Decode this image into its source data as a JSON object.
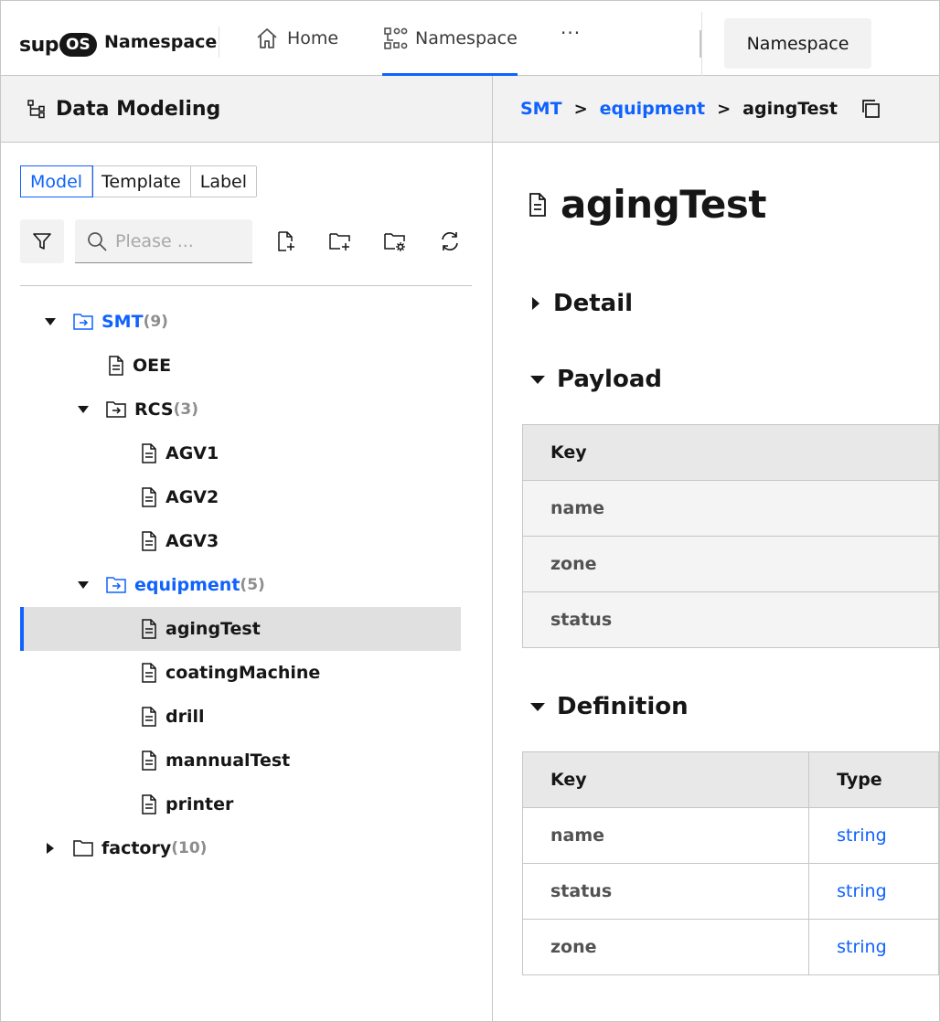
{
  "topnav": {
    "logo_sup": "sup",
    "logo_os": "OS",
    "app_name": "Namespace",
    "home_label": "Home",
    "namespace_label": "Namespace",
    "more_label": "···",
    "namespace_button": "Namespace"
  },
  "left": {
    "title": "Data Modeling",
    "tabs": [
      "Model",
      "Template",
      "Label"
    ],
    "active_tab": "Model",
    "search_placeholder": "Please ...",
    "tree": [
      {
        "label": "SMT",
        "count": "(9)"
      },
      {
        "label": "OEE"
      },
      {
        "label": "RCS",
        "count": "(3)"
      },
      {
        "label": "AGV1"
      },
      {
        "label": "AGV2"
      },
      {
        "label": "AGV3"
      },
      {
        "label": "equipment",
        "count": "(5)"
      },
      {
        "label": "agingTest"
      },
      {
        "label": "coatingMachine"
      },
      {
        "label": "drill"
      },
      {
        "label": "mannualTest"
      },
      {
        "label": "printer"
      },
      {
        "label": "factory",
        "count": "(10)"
      }
    ]
  },
  "breadcrumb": {
    "items": [
      "SMT",
      "equipment",
      "agingTest"
    ],
    "separator": ">"
  },
  "doc": {
    "title": "agingTest",
    "detail_label": "Detail",
    "payload_label": "Payload",
    "definition_label": "Definition",
    "payload": {
      "header": "Key",
      "rows": [
        "name",
        "zone",
        "status"
      ]
    },
    "definition": {
      "headers": [
        "Key",
        "Type"
      ],
      "rows": [
        {
          "key": "name",
          "type": "string"
        },
        {
          "key": "status",
          "type": "string"
        },
        {
          "key": "zone",
          "type": "string"
        }
      ]
    }
  },
  "colors": {
    "accent": "#0f62fe",
    "header_bg": "#f2f2f2",
    "selected_bg": "#e0e0e0"
  }
}
